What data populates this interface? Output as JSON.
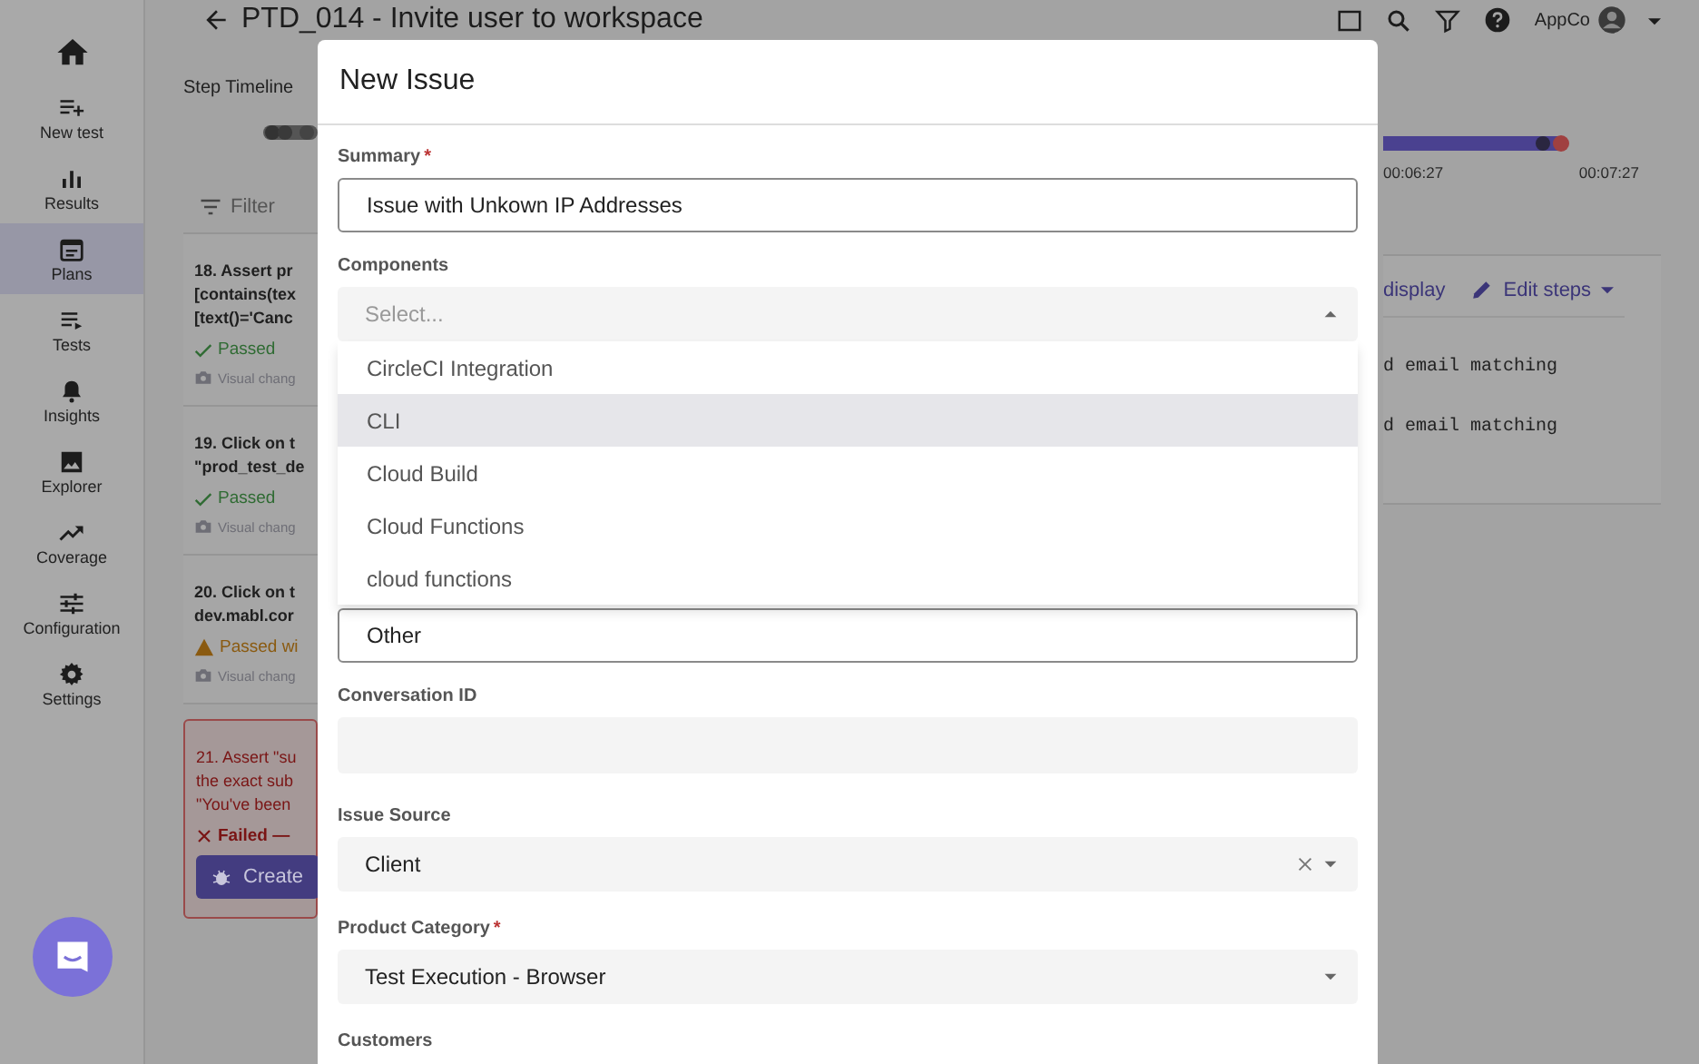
{
  "sidebar": {
    "items": [
      {
        "label": "New test",
        "selected": false
      },
      {
        "label": "Results",
        "selected": false
      },
      {
        "label": "Plans",
        "selected": true
      },
      {
        "label": "Tests",
        "selected": false
      },
      {
        "label": "Insights",
        "selected": false
      },
      {
        "label": "Explorer",
        "selected": false
      },
      {
        "label": "Coverage",
        "selected": false
      },
      {
        "label": "Configuration",
        "selected": false
      },
      {
        "label": "Settings",
        "selected": false
      }
    ]
  },
  "header": {
    "title": "PTD_014 - Invite user to workspace",
    "account": "AppCo"
  },
  "timeline": {
    "label": "Step Timeline",
    "times": [
      "00:06:27",
      "00:07:27"
    ]
  },
  "filter": {
    "placeholder": "Filter"
  },
  "steps": [
    {
      "lines": [
        "18. Assert pr",
        "[contains(tex",
        "[text()='Canc"
      ],
      "kind": "passed",
      "status_text": "Passed",
      "note": "Visual chang"
    },
    {
      "lines": [
        "19. Click on t",
        "\"prod_test_de"
      ],
      "kind": "passed",
      "status_text": "Passed",
      "note": "Visual chang"
    },
    {
      "lines": [
        "20. Click on t",
        "dev.mabl.cor"
      ],
      "kind": "warning",
      "status_text": "Passed wi",
      "note": "Visual chang"
    },
    {
      "lines": [
        "21. Assert \"su",
        "the exact sub",
        "\"You've been"
      ],
      "kind": "failed",
      "status_text": "Failed —",
      "button": "Create"
    }
  ],
  "detail": {
    "link": "display",
    "edit": "Edit steps",
    "lines": [
      "d email matching",
      "d email matching"
    ]
  },
  "modal": {
    "title": "New Issue",
    "fields": [
      {
        "kind": "input",
        "label": "Summary",
        "mark": "*",
        "value": "Issue with Unkown IP Addresses"
      },
      {
        "kind": "select",
        "label": "Components",
        "placeholder": "Select...",
        "expanded": true,
        "options": [
          {
            "label": "CircleCI Integration",
            "selected": false
          },
          {
            "label": "CLI",
            "selected": true
          },
          {
            "label": "Cloud Build",
            "selected": false
          },
          {
            "label": "Cloud Functions",
            "selected": false
          },
          {
            "label": "cloud functions",
            "selected": false
          }
        ]
      },
      {
        "kind": "input",
        "value": "Other"
      },
      {
        "kind": "filled",
        "label": "Conversation ID"
      },
      {
        "kind": "select",
        "label": "Issue Source",
        "value": "Client",
        "expanded": false,
        "clearable": true
      },
      {
        "kind": "select",
        "label": "Product Category",
        "mark": "*",
        "value": "Test Execution - Browser",
        "expanded": false,
        "clearable": false
      },
      {
        "kind": "label",
        "label": "Customers"
      }
    ]
  }
}
